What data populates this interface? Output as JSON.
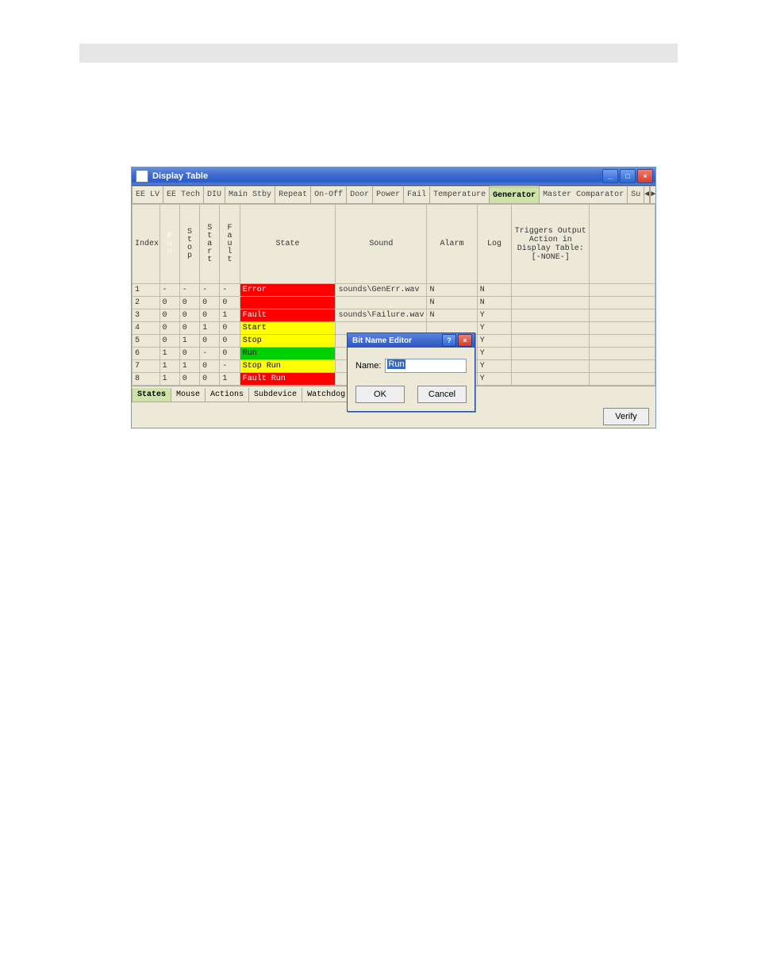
{
  "window": {
    "title": "Display Table",
    "btn_min": "_",
    "btn_max": "□",
    "btn_close": "×"
  },
  "top_tabs": {
    "items": [
      {
        "id": "ee-lv",
        "label": "EE LV"
      },
      {
        "id": "ee-tech",
        "label": "EE Tech"
      },
      {
        "id": "diu",
        "label": "DIU"
      },
      {
        "id": "mainstby",
        "label": "Main Stby"
      },
      {
        "id": "repeat",
        "label": "Repeat"
      },
      {
        "id": "onoff",
        "label": "On-Off"
      },
      {
        "id": "door",
        "label": "Door"
      },
      {
        "id": "power",
        "label": "Power"
      },
      {
        "id": "fail",
        "label": "Fail"
      },
      {
        "id": "temperature",
        "label": "Temperature"
      },
      {
        "id": "generator",
        "label": "Generator",
        "selected": true
      },
      {
        "id": "mastercomp",
        "label": "Master Comparator"
      },
      {
        "id": "su",
        "label": "Su"
      }
    ],
    "nav_left": "◄",
    "nav_right": "►"
  },
  "columns": {
    "index": "Index",
    "run": "Run",
    "stop": "Stop",
    "start": "Start",
    "fault": "Fault",
    "state": "State",
    "sound": "Sound",
    "alarm": "Alarm",
    "log": "Log",
    "trigger": "Triggers Output Action in Display Table: [-NONE-]",
    "last": ""
  },
  "rows": [
    {
      "idx": "1",
      "run": "-",
      "stop": "-",
      "start": "-",
      "fault": "-",
      "state": "Error",
      "stateClass": "rowError",
      "sound": "sounds\\GenErr.wav",
      "alarm": "N",
      "log": "N",
      "trigger": "",
      "last": ""
    },
    {
      "idx": "2",
      "run": "0",
      "stop": "0",
      "start": "0",
      "fault": "0",
      "state": "",
      "stateClass": "rowBlank",
      "sound": "",
      "alarm": "N",
      "log": "N",
      "trigger": "",
      "last": ""
    },
    {
      "idx": "3",
      "run": "0",
      "stop": "0",
      "start": "0",
      "fault": "1",
      "state": "Fault",
      "stateClass": "rowFault",
      "sound": "sounds\\Failure.wav",
      "alarm": "N",
      "log": "Y",
      "trigger": "",
      "last": ""
    },
    {
      "idx": "4",
      "run": "0",
      "stop": "0",
      "start": "1",
      "fault": "0",
      "state": "Start",
      "stateClass": "rowStart",
      "sound": "",
      "alarm": "",
      "log": "Y",
      "trigger": "",
      "last": ""
    },
    {
      "idx": "5",
      "run": "0",
      "stop": "1",
      "start": "0",
      "fault": "0",
      "state": "Stop",
      "stateClass": "rowStop",
      "sound": "",
      "alarm": "",
      "log": "Y",
      "trigger": "",
      "last": ""
    },
    {
      "idx": "6",
      "run": "1",
      "stop": "0",
      "start": "-",
      "fault": "0",
      "state": "Run",
      "stateClass": "rowRun",
      "sound": "",
      "alarm": "",
      "log": "Y",
      "trigger": "",
      "last": ""
    },
    {
      "idx": "7",
      "run": "1",
      "stop": "1",
      "start": "0",
      "fault": "-",
      "state": "Stop Run",
      "stateClass": "rowStopRun",
      "sound": "",
      "alarm": "",
      "log": "Y",
      "trigger": "",
      "last": ""
    },
    {
      "idx": "8",
      "run": "1",
      "stop": "0",
      "start": "0",
      "fault": "1",
      "state": "Fault Run",
      "stateClass": "rowFaultRun",
      "sound": "",
      "alarm": "",
      "log": "Y",
      "trigger": "",
      "last": ""
    }
  ],
  "bottom_tabs": {
    "items": [
      {
        "id": "states",
        "label": "States",
        "selected": true
      },
      {
        "id": "mouse",
        "label": "Mouse"
      },
      {
        "id": "actions",
        "label": "Actions"
      },
      {
        "id": "subdevice",
        "label": "Subdevice"
      },
      {
        "id": "watchdog",
        "label": "Watchdog"
      }
    ]
  },
  "verify_btn": "Verify",
  "dialog": {
    "title": "Bit Name Editor",
    "help": "?",
    "close": "×",
    "name_label": "Name:",
    "name_value": "Run",
    "ok": "OK",
    "cancel": "Cancel"
  }
}
